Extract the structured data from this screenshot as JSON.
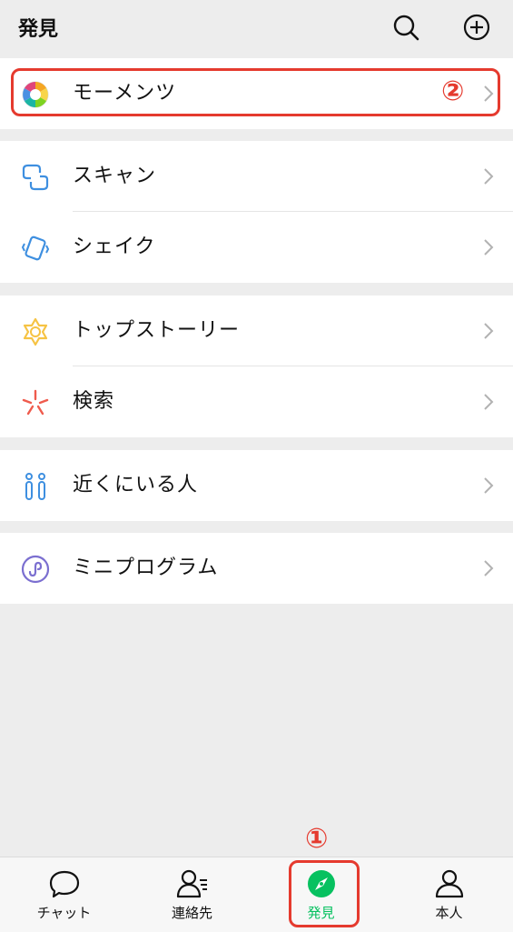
{
  "header": {
    "title": "発見",
    "icons": [
      "search-icon",
      "add-circle-icon"
    ]
  },
  "menu": {
    "moments": {
      "label": "モーメンツ",
      "icon": "moments-aperture-icon"
    },
    "scan": {
      "label": "スキャン",
      "icon": "scan-icon"
    },
    "shake": {
      "label": "シェイク",
      "icon": "shake-icon"
    },
    "top_stories": {
      "label": "トップストーリー",
      "icon": "top-stories-icon"
    },
    "search": {
      "label": "検索",
      "icon": "search-star-icon"
    },
    "nearby": {
      "label": "近くにいる人",
      "icon": "people-nearby-icon"
    },
    "mini_programs": {
      "label": "ミニプログラム",
      "icon": "mini-program-icon"
    }
  },
  "annotations": {
    "marker_1": "①",
    "marker_2": "②",
    "color": "#e53a2e"
  },
  "tabbar": {
    "tabs": [
      {
        "label": "チャット",
        "icon": "chat-bubble-icon"
      },
      {
        "label": "連絡先",
        "icon": "contacts-icon"
      },
      {
        "label": "発見",
        "icon": "discover-compass-icon",
        "active": true
      },
      {
        "label": "本人",
        "icon": "person-icon"
      }
    ],
    "active_color": "#07c160"
  }
}
